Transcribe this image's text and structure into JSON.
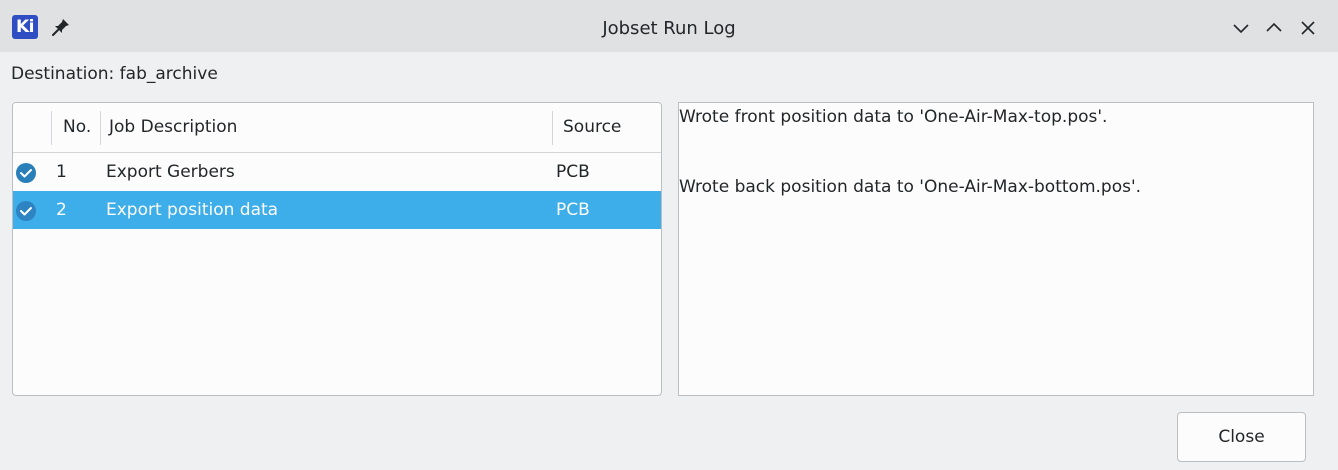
{
  "window": {
    "title": "Jobset Run Log",
    "logo_text": "Ki",
    "controls": [
      "minimize-icon",
      "maximize-icon",
      "close-icon"
    ]
  },
  "destination_label": "Destination: fab_archive",
  "jobs_table": {
    "columns": [
      "",
      "No.",
      "Job Description",
      "Source"
    ],
    "rows": [
      {
        "status": "check-circle-icon",
        "no": "1",
        "description": "Export Gerbers",
        "source": "PCB",
        "selected": false
      },
      {
        "status": "check-circle-icon",
        "no": "2",
        "description": "Export position data",
        "source": "PCB",
        "selected": true
      }
    ]
  },
  "log": {
    "lines": [
      "Wrote front position data to 'One-Air-Max-top.pos'.",
      "",
      "Wrote back position data to 'One-Air-Max-bottom.pos'."
    ]
  },
  "buttons": {
    "close_label": "Close"
  },
  "colors": {
    "selection": "#3daee9",
    "check": "#2980b9",
    "logo": "#2f4ec4"
  }
}
